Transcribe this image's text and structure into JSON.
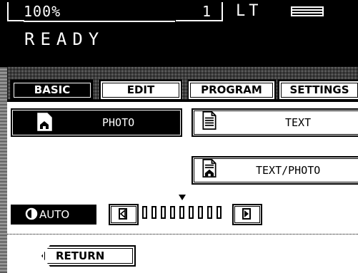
{
  "status": {
    "zoom": "100%",
    "copy_count": "1",
    "paper_size": "LT",
    "message": "READY",
    "tray_icon": "paper-tray-icon"
  },
  "tabs": [
    {
      "label": "BASIC",
      "active": true
    },
    {
      "label": "EDIT",
      "active": false
    },
    {
      "label": "PROGRAM",
      "active": false
    },
    {
      "label": "SETTINGS",
      "active": false
    }
  ],
  "modes": {
    "photo": {
      "label": "PHOTO",
      "icon": "photo-document-icon",
      "selected": true
    },
    "text": {
      "label": "TEXT",
      "icon": "text-document-icon",
      "selected": false
    },
    "text_photo": {
      "label": "TEXT/PHOTO",
      "icon": "text-photo-document-icon",
      "selected": false
    }
  },
  "density": {
    "auto_label": "AUTO",
    "auto_icon": "auto-density-icon",
    "lighter_icon": "density-lighter-icon",
    "darker_icon": "density-darker-icon",
    "levels": 9,
    "current_level": 5
  },
  "return_label": "RETURN"
}
